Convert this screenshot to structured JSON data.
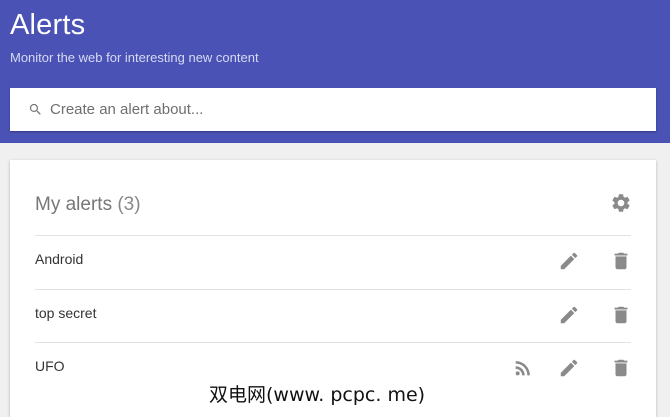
{
  "header": {
    "title": "Alerts",
    "subtitle": "Monitor the web for interesting new content",
    "background": "#4a52b6"
  },
  "search": {
    "placeholder": "Create an alert about...",
    "value": "",
    "icon": "search-icon"
  },
  "my_alerts": {
    "title": "My alerts",
    "count": "(3)",
    "settings_icon": "gear-icon",
    "items": [
      {
        "name": "Android",
        "rss": false
      },
      {
        "name": "top secret",
        "rss": false
      },
      {
        "name": "UFO",
        "rss": true
      }
    ],
    "row_icons": {
      "rss": "rss-icon",
      "edit": "pencil-icon",
      "delete": "trash-icon"
    }
  },
  "watermark": {
    "text": "双电网(www. pcpc. me)"
  }
}
